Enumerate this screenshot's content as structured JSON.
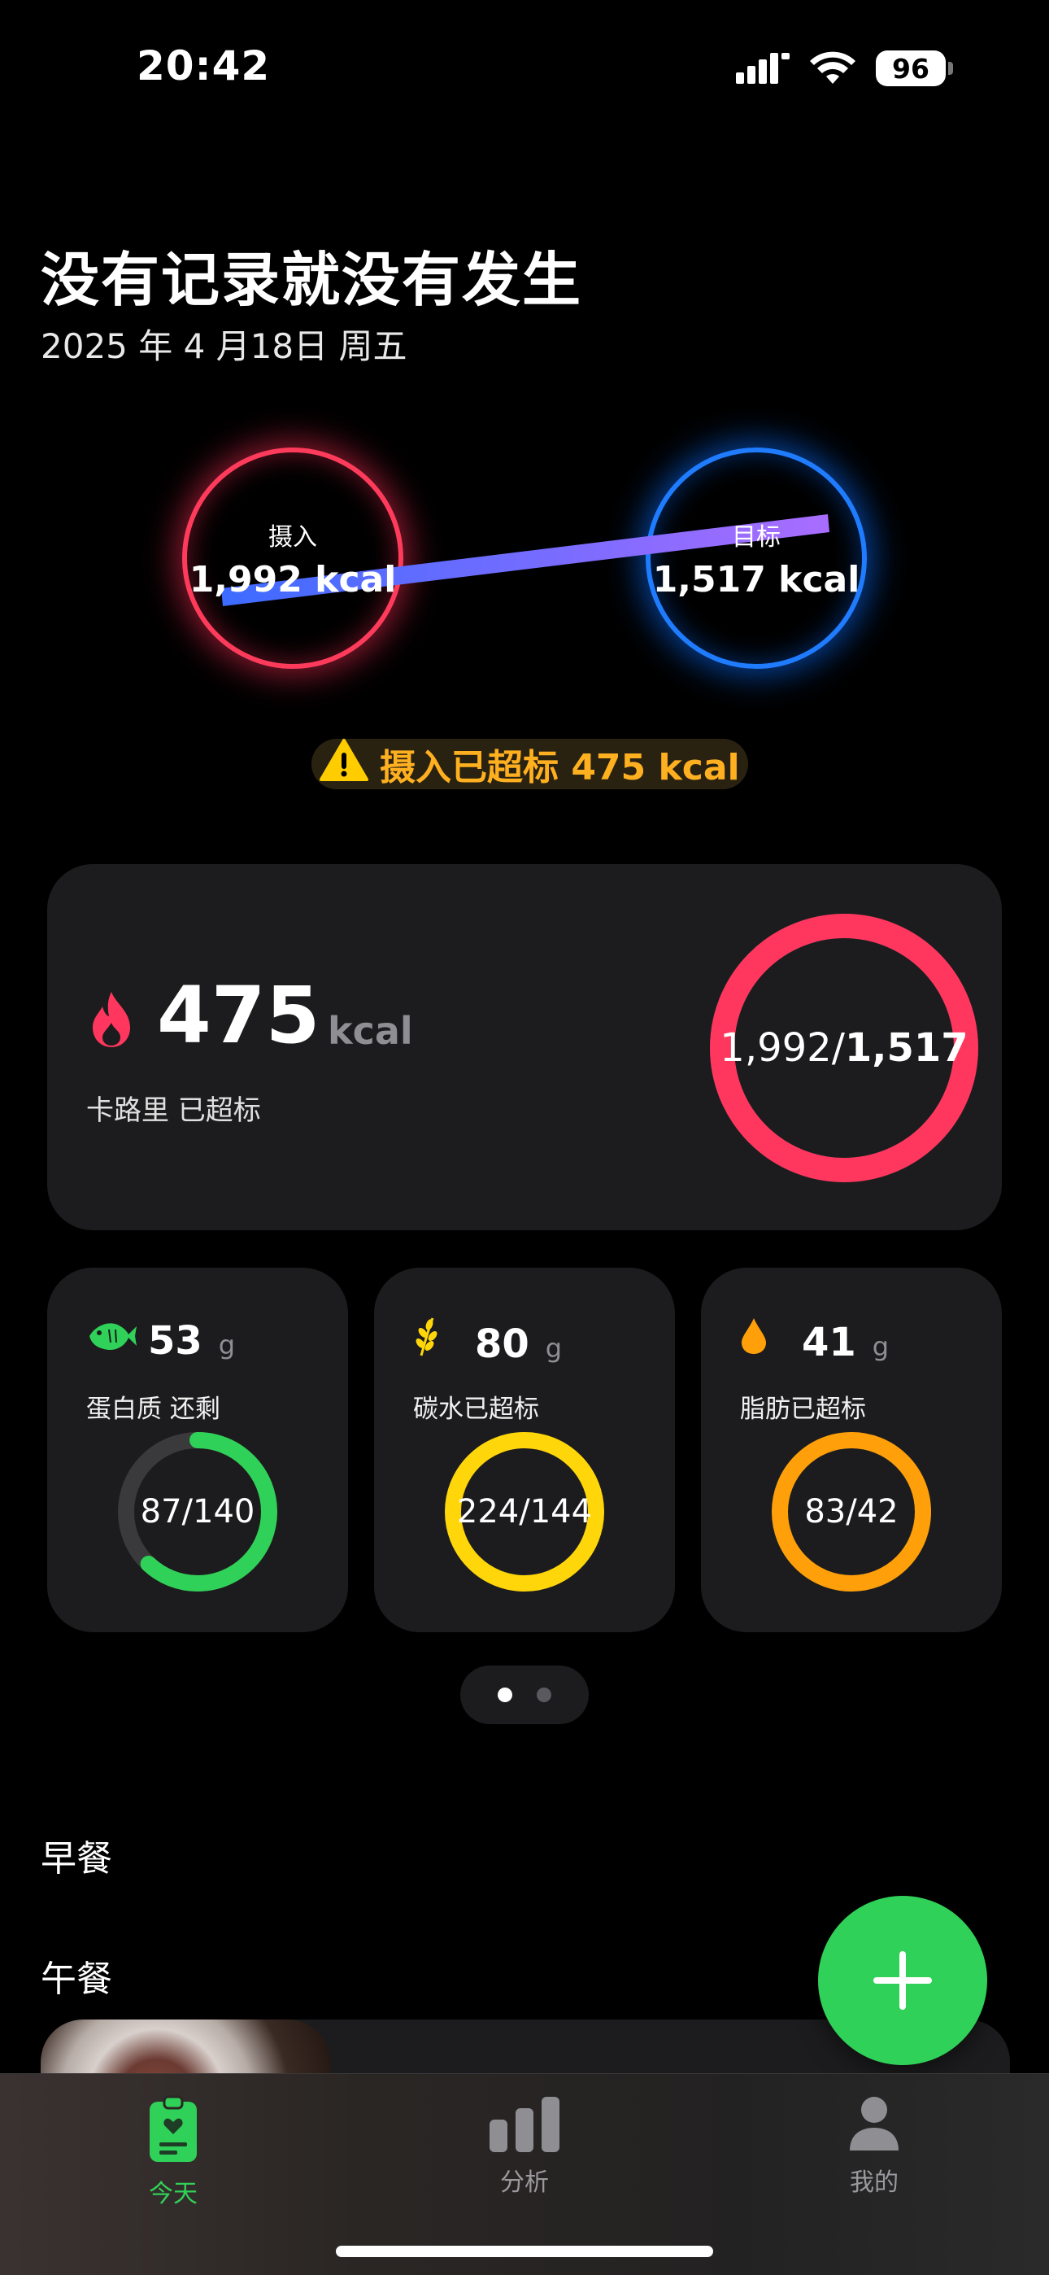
{
  "status_bar": {
    "time": "20:42",
    "battery": "96"
  },
  "header": {
    "title": "没有记录就没有发生",
    "date": "2025 年 4 月18日 周五"
  },
  "compare": {
    "intake_label": "摄入",
    "intake_value": "1,992 kcal",
    "target_label": "目标",
    "target_value": "1,517 kcal"
  },
  "warning": {
    "text": "摄入已超标 475 kcal"
  },
  "calories": {
    "value": "475",
    "unit": "kcal",
    "status": "卡路里 已超标",
    "consumed": "1,992",
    "target": "1,517",
    "progress": 1.0,
    "ring_color": "#ff375f"
  },
  "macros": [
    {
      "value": "53",
      "unit": "g",
      "label": "蛋白质 还剩",
      "ratio": "87/140",
      "progress": 0.62,
      "color": "#30d158",
      "icon": "fish-icon"
    },
    {
      "value": "80",
      "unit": "g",
      "label": "碳水已超标",
      "ratio": "224/144",
      "progress": 1.0,
      "color": "#ffd60a",
      "icon": "wheat-icon"
    },
    {
      "value": "41",
      "unit": "g",
      "label": "脂肪已超标",
      "ratio": "83/42",
      "progress": 1.0,
      "color": "#ff9f0a",
      "icon": "drop-icon"
    }
  ],
  "meals": {
    "breakfast": "早餐",
    "lunch": "午餐"
  },
  "tabs": {
    "today": "今天",
    "analysis": "分析",
    "mine": "我的"
  },
  "colors": {
    "accent": "#30d158",
    "warning": "#ffb020",
    "intake": "#ff375f",
    "target": "#0a84ff"
  }
}
